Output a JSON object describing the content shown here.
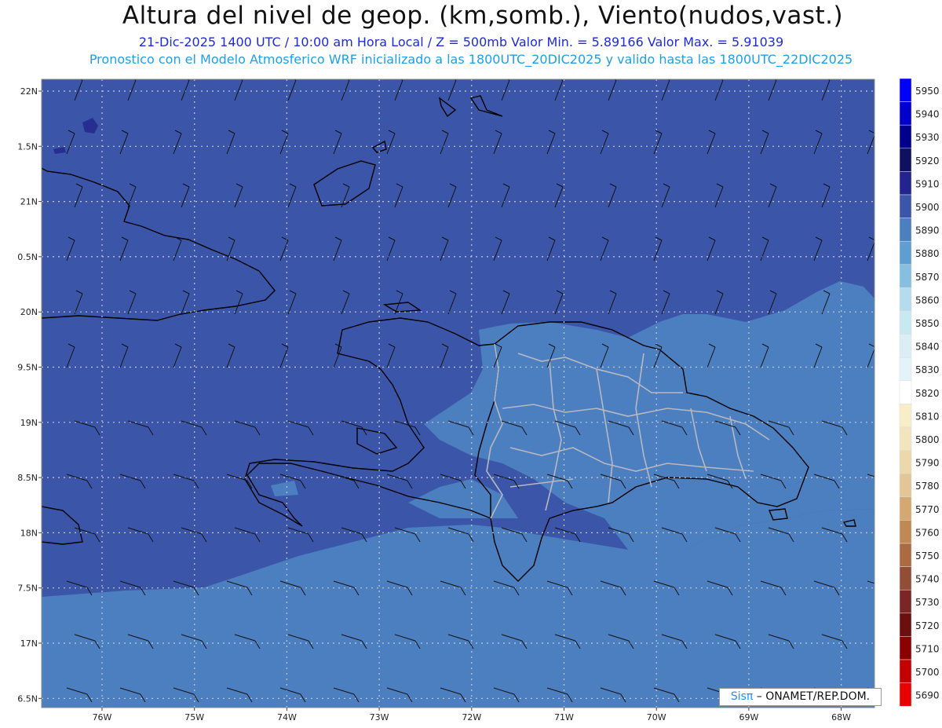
{
  "title": "Altura del nivel de geop. (km,somb.), Viento(nudos,vast.)",
  "subtitle1": "21-Dic-2025  1400 UTC / 10:00 am Hora Local / Z = 500mb    Valor Min. = 5.89166  Valor Max. = 5.91039",
  "subtitle2": "Pronostico con el Modelo Atmosferico WRF inicializado a las 1800UTC_20DIC2025 y valido hasta las  1800UTC_22DIC2025",
  "credit": {
    "sis": "Sisπ",
    "org": " – ONAMET/REP.DOM."
  },
  "axes": {
    "lat_labels": [
      "22N",
      "1.5N",
      "21N",
      "0.5N",
      "20N",
      "9.5N",
      "19N",
      "8.5N",
      "18N",
      "7.5N",
      "17N",
      "6.5N"
    ],
    "lon_labels": [
      "76W",
      "75W",
      "74W",
      "73W",
      "72W",
      "71W",
      "70W",
      "69W",
      "68W"
    ]
  },
  "colorbar": {
    "labels": [
      "5950",
      "5940",
      "5930",
      "5920",
      "5910",
      "5900",
      "5890",
      "5880",
      "5870",
      "5860",
      "5850",
      "5840",
      "5830",
      "5820",
      "5810",
      "5800",
      "5790",
      "5780",
      "5770",
      "5760",
      "5750",
      "5740",
      "5730",
      "5720",
      "5710",
      "5700",
      "5690"
    ],
    "colors": [
      "#0000ff",
      "#0000cc",
      "#00008c",
      "#101060",
      "#22238f",
      "#3b56a9",
      "#4c7fbf",
      "#5f9ed3",
      "#86bfe0",
      "#b5dcec",
      "#c8e9f2",
      "#dceef5",
      "#e4f3f7",
      "#ffffff",
      "#f7edc6",
      "#f2e4bd",
      "#ecd9ab",
      "#e3c596",
      "#d4a870",
      "#c08852",
      "#ac6a40",
      "#924d36",
      "#7b2626",
      "#6b0f0f",
      "#8b0000",
      "#c40000",
      "#e60000"
    ]
  },
  "colors": {
    "field_main": "#3b56a9",
    "field_south": "#4c7fbf",
    "field_high": "#262f8f",
    "field_low": "#5f9ed3"
  }
}
